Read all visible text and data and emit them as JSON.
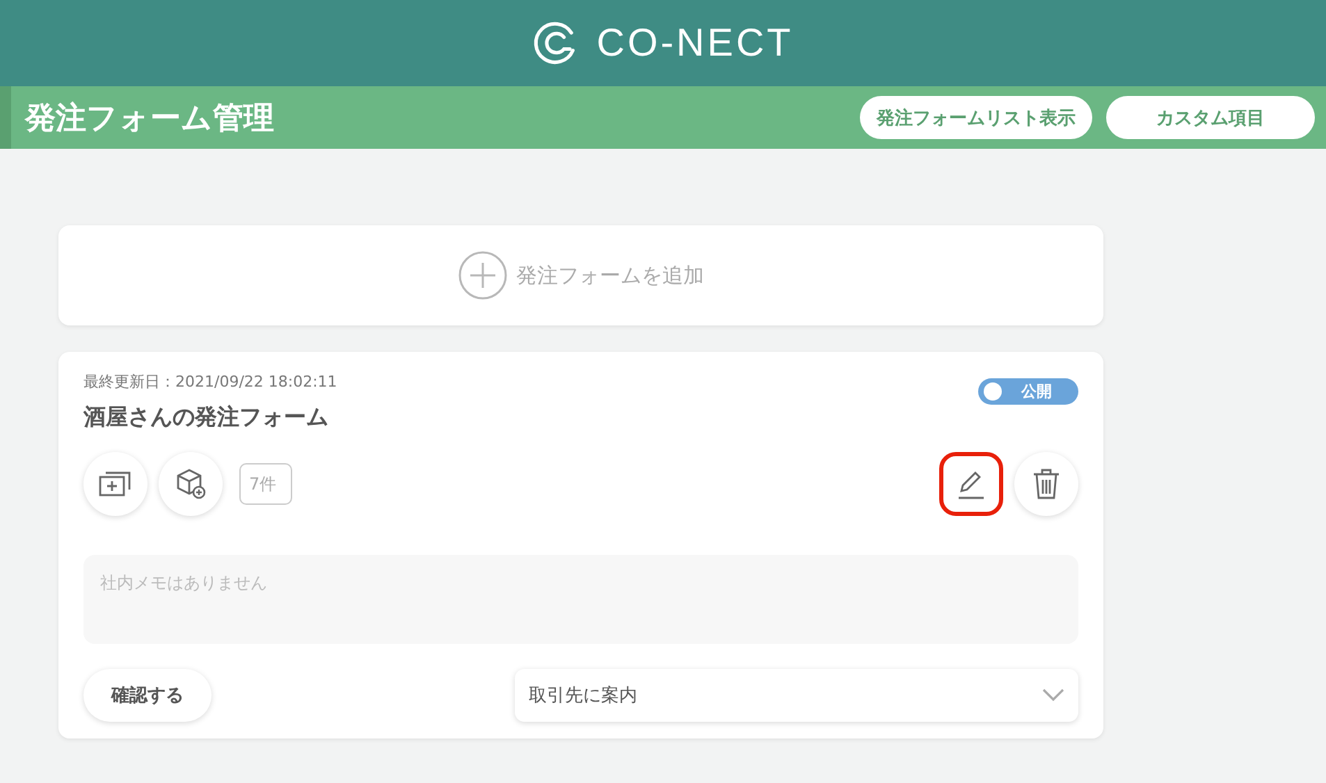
{
  "header": {
    "logo_text": "CO-NECT"
  },
  "title_bar": {
    "title": "発注フォーム管理",
    "buttons": [
      "発注フォームリスト表示",
      "カスタム項目"
    ]
  },
  "add_card": {
    "label": "発注フォームを追加"
  },
  "form_card": {
    "updated": "最終更新日：2021/09/22 18:02:11",
    "name": "酒屋さんの発注フォーム",
    "publish_toggle": {
      "label": "公開",
      "on": true
    },
    "item_count": "7件",
    "edit_highlighted": true,
    "memo": {
      "placeholder": "社内メモはありません"
    },
    "confirm_button": "確認する",
    "share_select": {
      "value": "取引先に案内"
    }
  }
}
